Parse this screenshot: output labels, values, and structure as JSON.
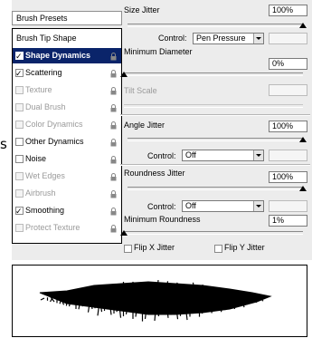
{
  "side_text": "s",
  "left": {
    "presets_label": "Brush Presets",
    "items": [
      {
        "label": "Brush Tip Shape",
        "header": true
      },
      {
        "label": "Shape Dynamics",
        "checked": true,
        "selected": true,
        "lock": true
      },
      {
        "label": "Scattering",
        "checked": true,
        "lock": true
      },
      {
        "label": "Texture",
        "disabled": true,
        "lock": true
      },
      {
        "label": "Dual Brush",
        "disabled": true,
        "lock": true
      },
      {
        "label": "Color Dynamics",
        "disabled": true,
        "lock": true
      },
      {
        "label": "Other Dynamics",
        "lock": true
      },
      {
        "label": "Noise",
        "lock": true
      },
      {
        "label": "Wet Edges",
        "disabled": true,
        "lock": true
      },
      {
        "label": "Airbrush",
        "disabled": true,
        "lock": true
      },
      {
        "label": "Smoothing",
        "checked": true,
        "lock": true
      },
      {
        "label": "Protect Texture",
        "disabled": true,
        "lock": true
      }
    ]
  },
  "right": {
    "size_jitter_label": "Size Jitter",
    "size_jitter_value": "100%",
    "control_label": "Control:",
    "size_control_value": "Pen Pressure",
    "min_diameter_label": "Minimum Diameter",
    "min_diameter_value": "0%",
    "tilt_scale_label": "Tilt Scale",
    "angle_jitter_label": "Angle Jitter",
    "angle_jitter_value": "100%",
    "angle_control_value": "Off",
    "roundness_jitter_label": "Roundness Jitter",
    "roundness_jitter_value": "100%",
    "roundness_control_value": "Off",
    "min_roundness_label": "Minimum Roundness",
    "min_roundness_value": "1%",
    "flip_x_label": "Flip X Jitter",
    "flip_y_label": "Flip Y Jitter"
  }
}
